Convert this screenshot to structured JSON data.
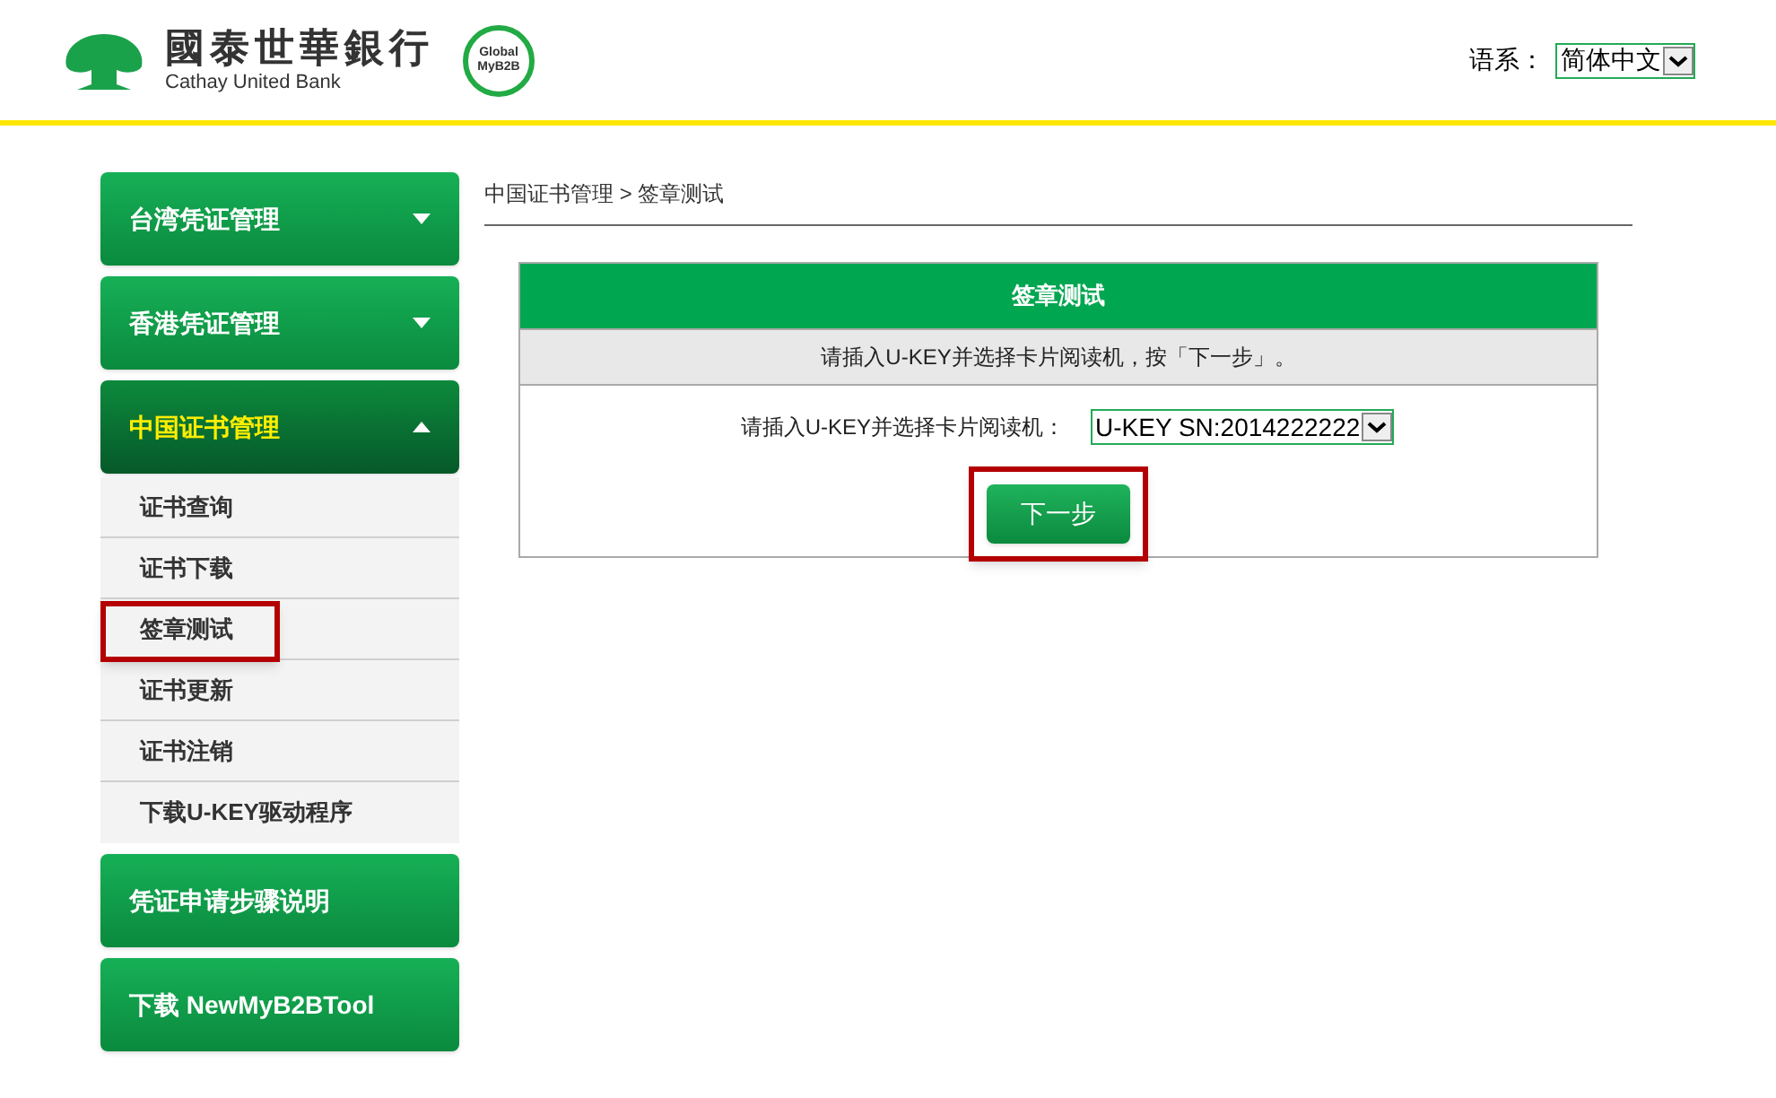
{
  "header": {
    "bank_name": "國泰世華銀行",
    "bank_name_en": "Cathay United Bank",
    "badge": [
      "Global",
      "MyB2B"
    ],
    "language_label": "语系：",
    "language_select": {
      "value": "简体中文"
    }
  },
  "sidebar": {
    "items": [
      {
        "kind": "menu",
        "label": "台湾凭证管理",
        "expanded": false
      },
      {
        "kind": "menu",
        "label": "香港凭证管理",
        "expanded": false
      },
      {
        "kind": "menu",
        "label": "中国证书管理",
        "expanded": true,
        "children": [
          {
            "label": "证书查询",
            "highlighted": false
          },
          {
            "label": "证书下载",
            "highlighted": false
          },
          {
            "label": "签章测试",
            "highlighted": true
          },
          {
            "label": "证书更新",
            "highlighted": false
          },
          {
            "label": "证书注销",
            "highlighted": false
          },
          {
            "label": "下载U-KEY驱动程序",
            "highlighted": false
          }
        ]
      },
      {
        "kind": "link",
        "label": "凭证申请步骤说明"
      },
      {
        "kind": "link",
        "label": "下载 NewMyB2BTool"
      }
    ]
  },
  "breadcrumb": "中国证书管理 > 签章测试",
  "panel": {
    "title": "签章测试",
    "instruction": "请插入U-KEY并选择卡片阅读机，按「下一步」。",
    "field_label": "请插入U-KEY并选择卡片阅读机：",
    "reader_select": {
      "value": "U-KEY SN:2014222222"
    },
    "next_button": {
      "label": "下一步",
      "highlighted": true
    }
  }
}
